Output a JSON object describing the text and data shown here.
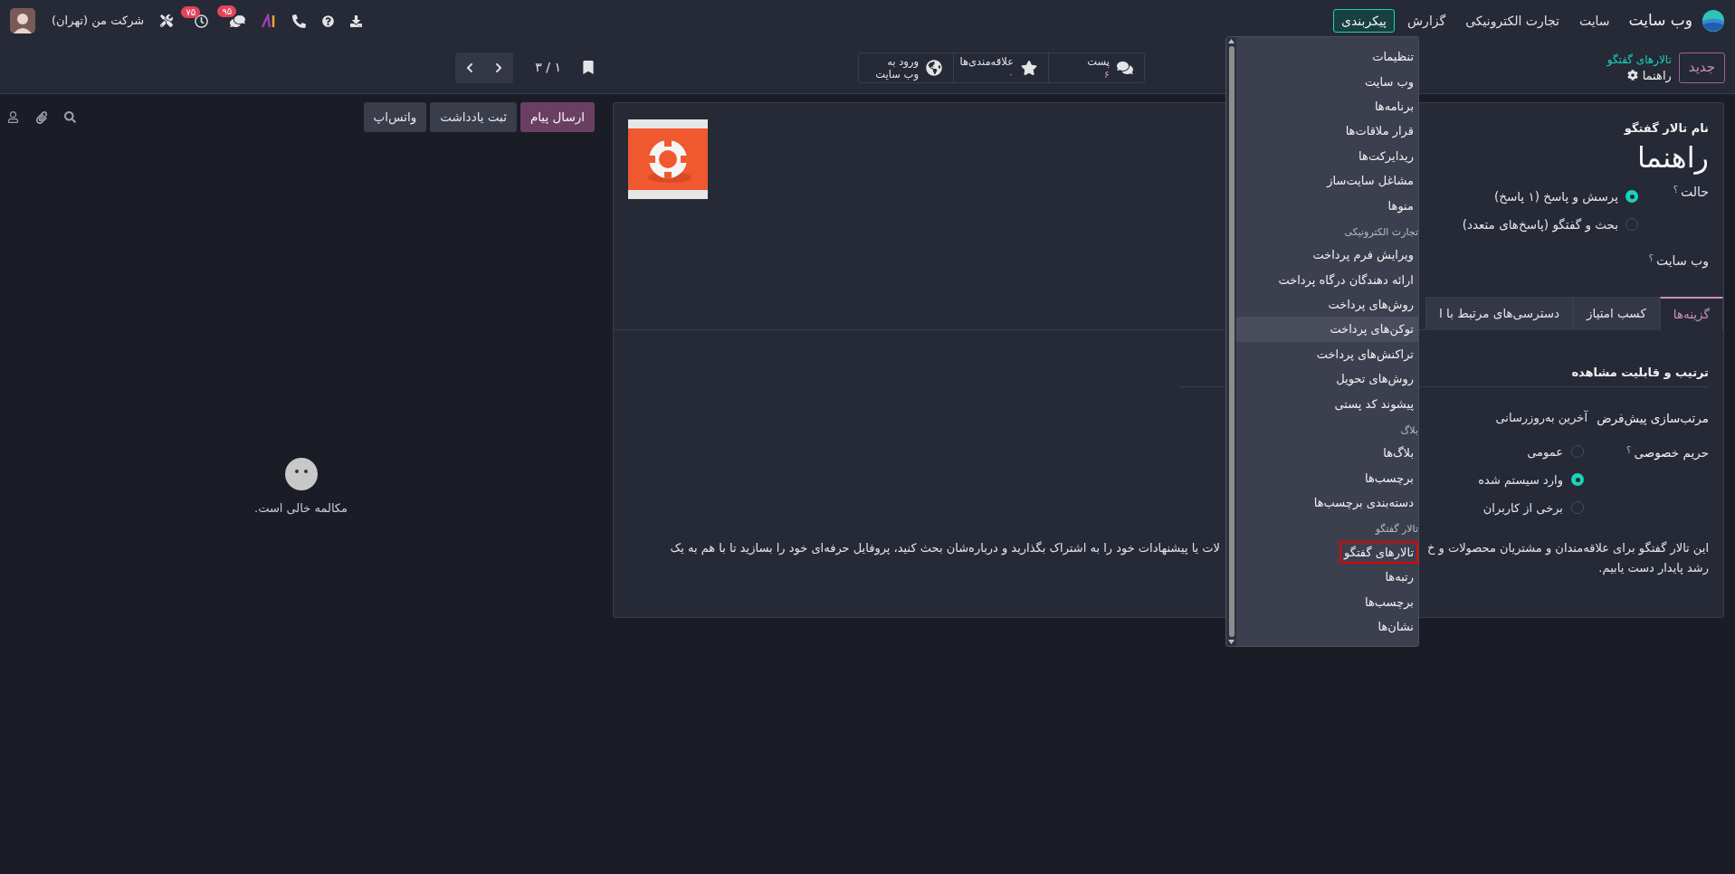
{
  "navbar": {
    "app_name": "وب سایت",
    "menus": [
      {
        "label": "سایت",
        "selected": false
      },
      {
        "label": "تجارت الکترونیکی",
        "selected": false
      },
      {
        "label": "گزارش",
        "selected": false
      },
      {
        "label": "پیکربندی",
        "selected": true
      }
    ],
    "systray": {
      "chat_badge": "۹۵",
      "activity_badge": "۷۵",
      "company": "شرکت من (تهران)"
    }
  },
  "control_panel": {
    "new_button": "جدید",
    "breadcrumb": "تالارهای گفتگو",
    "record_name": "راهنما",
    "stat_buttons": [
      {
        "kind": "posts",
        "label": "پست",
        "value": "۶"
      },
      {
        "kind": "favorites",
        "label": "علاقه‌مندی‌ها",
        "value": "۰"
      },
      {
        "kind": "website",
        "label": "ورود به",
        "label_2": "وب سایت"
      }
    ],
    "pager": "۱ / ۳"
  },
  "form": {
    "name_label": "نام تالار گفتگو",
    "name": "راهنما",
    "mode_field": {
      "label": "حالت",
      "help": "؟",
      "options": [
        {
          "label": "پرسش و پاسخ (۱ پاسخ)",
          "selected": true
        },
        {
          "label": "بحث و گفتگو (پاسخ‌های متعدد)",
          "selected": false
        }
      ]
    },
    "website_field": {
      "label": "وب سایت",
      "help": "؟"
    },
    "tabs": [
      {
        "label": "گزینه‌ها",
        "selected": true
      },
      {
        "label": "کسب امتیاز",
        "selected": false
      },
      {
        "label": "دسترسی‌های مرتبط با ا",
        "selected": false
      }
    ],
    "section_title": "ترتیب و قابلیت مشاهده",
    "sort_field": {
      "label": "مرتب‌سازی پیش‌فرض",
      "value": "آخرین به‌روزرسانی"
    },
    "privacy_field": {
      "label": "حریم خصوصی",
      "help": "؟",
      "options": [
        {
          "label": "عمومی",
          "selected": false
        },
        {
          "label": "وارد سیستم شده",
          "selected": true
        },
        {
          "label": "برخی از کاربران",
          "selected": false
        }
      ]
    },
    "description": [
      "این تالار گفتگو برای علاقه‌مندان و مشتریان محصولات و خ",
      "لات یا پیشنهادات خود را به اشتراک بگذارید و درباره‌شان بحث کنید، پروفایل حرفه‌ای خود را بسازید تا با هم به یک",
      "رشد پایدار دست یابیم."
    ]
  },
  "chatter": {
    "buttons": [
      {
        "label": "ارسال پیام",
        "kind": "primary"
      },
      {
        "label": "ثبت یادداشت",
        "kind": "secondary"
      },
      {
        "label": "واتس‌اپ",
        "kind": "secondary"
      }
    ],
    "empty_text": "مکالمه خالی است."
  },
  "menu": {
    "items": [
      {
        "kind": "item",
        "label": "تنظیمات",
        "hovered": false,
        "outlined": false
      },
      {
        "kind": "item",
        "label": "وب سایت",
        "hovered": false,
        "outlined": false
      },
      {
        "kind": "item",
        "label": "برنامه‌ها",
        "hovered": false,
        "outlined": false
      },
      {
        "kind": "item",
        "label": "قرار ملاقات‌ها",
        "hovered": false,
        "outlined": false
      },
      {
        "kind": "item",
        "label": "ریدایرکت‌ها",
        "hovered": false,
        "outlined": false
      },
      {
        "kind": "item",
        "label": "مشاغل سایت‌ساز",
        "hovered": false,
        "outlined": false
      },
      {
        "kind": "item",
        "label": "منوها",
        "hovered": false,
        "outlined": false
      },
      {
        "kind": "header",
        "label": "تجارت الکترونیکی"
      },
      {
        "kind": "item",
        "label": "ویرایش فرم پرداخت",
        "hovered": false,
        "outlined": false
      },
      {
        "kind": "item",
        "label": "ارائه دهندگان درگاه پرداخت",
        "hovered": false,
        "outlined": false
      },
      {
        "kind": "item",
        "label": "روش‌های پرداخت",
        "hovered": false,
        "outlined": false
      },
      {
        "kind": "item",
        "label": "توکن‌های پرداخت",
        "hovered": true,
        "outlined": false
      },
      {
        "kind": "item",
        "label": "تراکنش‌های پرداخت",
        "hovered": false,
        "outlined": false
      },
      {
        "kind": "item",
        "label": "روش‌های تحویل",
        "hovered": false,
        "outlined": false
      },
      {
        "kind": "item",
        "label": "پیشوند کد پستی",
        "hovered": false,
        "outlined": false
      },
      {
        "kind": "header",
        "label": "بلاگ"
      },
      {
        "kind": "item",
        "label": "بلاگ‌ها",
        "hovered": false,
        "outlined": false
      },
      {
        "kind": "item",
        "label": "برچسب‌ها",
        "hovered": false,
        "outlined": false
      },
      {
        "kind": "item",
        "label": "دسته‌بندی برچسب‌ها",
        "hovered": false,
        "outlined": false
      },
      {
        "kind": "header",
        "label": "تالار گفتگو"
      },
      {
        "kind": "item",
        "label": "تالارهای گفتگو",
        "hovered": false,
        "outlined": true
      },
      {
        "kind": "item",
        "label": "رتبه‌ها",
        "hovered": false,
        "outlined": false
      },
      {
        "kind": "item",
        "label": "برچسب‌ها",
        "hovered": false,
        "outlined": false
      },
      {
        "kind": "item",
        "label": "نشان‌ها",
        "hovered": false,
        "outlined": false
      }
    ]
  }
}
